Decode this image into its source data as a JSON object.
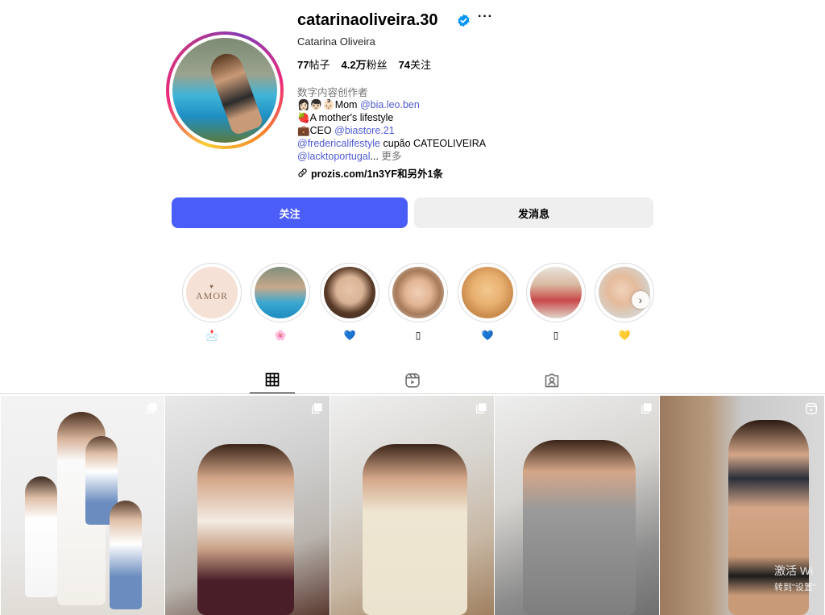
{
  "profile": {
    "username": "catarinaoliveira.30",
    "full_name": "Catarina Oliveira",
    "more_icon": "more-horizontal-icon",
    "verified_icon": "verified-badge-icon",
    "stats": {
      "posts_count": "77",
      "posts_label": "帖子",
      "followers_count": "4.2万",
      "followers_label": "粉丝",
      "following_count": "74",
      "following_label": "关注"
    },
    "category": "数字内容创作者",
    "bio": {
      "line1_prefix": "👩🏻👦🏻👶🏻Mom ",
      "line1_mention": "@bia.leo.ben",
      "line2": "🍓A mother's lifestyle",
      "line3_prefix": "💼CEO ",
      "line3_mention": "@biastore.21",
      "line4_mention": "@fredericalifestyle",
      "line4_suffix": " cupão CATEOLIVEIRA",
      "line5_mention": "@lacktoportugal",
      "line5_ellipsis": "...",
      "more_label": " 更多"
    },
    "link_text": "prozis.com/1n3YF和另外1条",
    "link_icon": "link-icon"
  },
  "actions": {
    "follow_label": "关注",
    "message_label": "发消息",
    "follow_color": "#4a5df9"
  },
  "highlights": [
    {
      "label": "📩",
      "cover_text": "AMOR"
    },
    {
      "label": "🌸"
    },
    {
      "label": "💙"
    },
    {
      "label": "▯"
    },
    {
      "label": "💙"
    },
    {
      "label": "▯"
    },
    {
      "label": "💛"
    }
  ],
  "tabs": [
    {
      "icon": "grid-icon",
      "active": true
    },
    {
      "icon": "reels-icon",
      "active": false
    },
    {
      "icon": "tagged-icon",
      "active": false
    }
  ],
  "watermark": {
    "line1": "激活 Wi",
    "line2": "转到\"设置\""
  }
}
